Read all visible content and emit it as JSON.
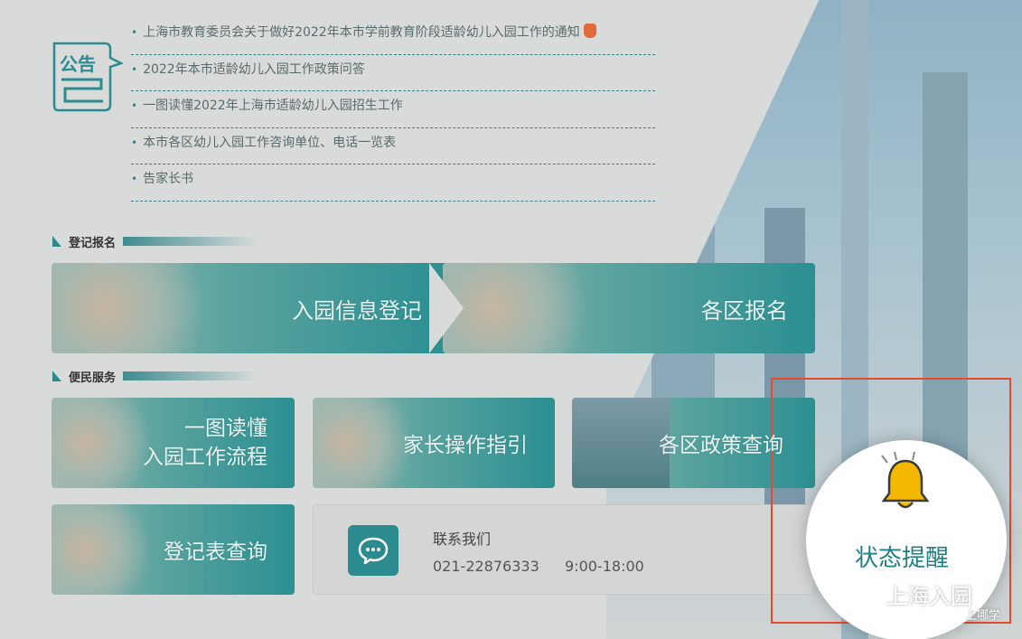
{
  "notice": {
    "icon_label": "公告",
    "items": [
      "上海市教育委员会关于做好2022年本市学前教育阶段适龄幼儿入园工作的通知",
      "2022年本市适龄幼儿入园工作政策问答",
      "一图读懂2022年上海市适龄幼儿入园招生工作",
      "本市各区幼儿入园工作咨询单位、电话一览表",
      "告家长书"
    ]
  },
  "registration": {
    "section_label": "登记报名",
    "tiles": [
      "入园信息登记",
      "各区报名"
    ]
  },
  "services": {
    "section_label": "便民服务",
    "tile_guide_line1": "一图读懂",
    "tile_guide_line2": "入园工作流程",
    "tile_parent": "家长操作指引",
    "tile_policy": "各区政策查询",
    "tile_form": "登记表查询"
  },
  "contact": {
    "title": "联系我们",
    "phone": "021-22876333",
    "hours": "9:00-18:00"
  },
  "status": {
    "label": "状态提醒"
  },
  "watermark": {
    "main": "上海入园",
    "sub": "上哪学"
  },
  "colors": {
    "accent": "#2b8b8f",
    "highlight": "#e64a2e",
    "bell": "#f5b800"
  }
}
